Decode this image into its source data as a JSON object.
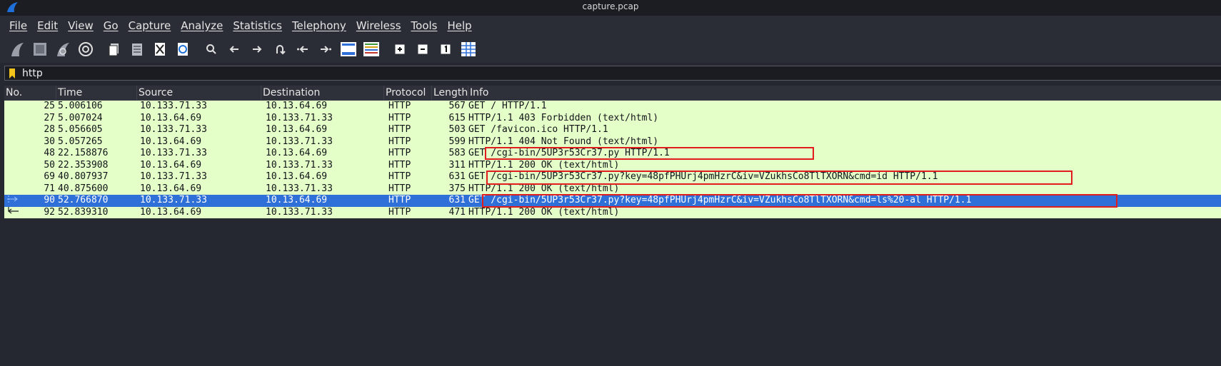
{
  "window": {
    "title": "capture.pcap"
  },
  "menu": [
    "File",
    "Edit",
    "View",
    "Go",
    "Capture",
    "Analyze",
    "Statistics",
    "Telephony",
    "Wireless",
    "Tools",
    "Help"
  ],
  "toolbar": [
    "start-capture-icon",
    "stop-capture-icon",
    "restart-capture-icon",
    "capture-options-icon",
    "open-file-icon",
    "save-file-icon",
    "close-file-icon",
    "reload-file-icon",
    "find-packet-icon",
    "go-back-icon",
    "go-forward-icon",
    "go-to-packet-icon",
    "first-packet-icon",
    "last-packet-icon",
    "auto-scroll-icon",
    "colorize-icon",
    "zoom-in-icon",
    "zoom-out-icon",
    "normal-size-icon",
    "resize-columns-icon"
  ],
  "filter": {
    "value": "http"
  },
  "columns": {
    "no": "No.",
    "time": "Time",
    "source": "Source",
    "destination": "Destination",
    "protocol": "Protocol",
    "length": "Length",
    "info": "Info"
  },
  "packets": [
    {
      "no": "25",
      "time": "5.006106",
      "source": "10.133.71.33",
      "destination": "10.13.64.69",
      "protocol": "HTTP",
      "length": "567",
      "info": "GET / HTTP/1.1"
    },
    {
      "no": "27",
      "time": "5.007024",
      "source": "10.13.64.69",
      "destination": "10.133.71.33",
      "protocol": "HTTP",
      "length": "615",
      "info": "HTTP/1.1 403 Forbidden  (text/html)"
    },
    {
      "no": "28",
      "time": "5.056605",
      "source": "10.133.71.33",
      "destination": "10.13.64.69",
      "protocol": "HTTP",
      "length": "503",
      "info": "GET /favicon.ico HTTP/1.1"
    },
    {
      "no": "30",
      "time": "5.057265",
      "source": "10.13.64.69",
      "destination": "10.133.71.33",
      "protocol": "HTTP",
      "length": "599",
      "info": "HTTP/1.1 404 Not Found  (text/html)"
    },
    {
      "no": "48",
      "time": "22.158876",
      "source": "10.133.71.33",
      "destination": "10.13.64.69",
      "protocol": "HTTP",
      "length": "583",
      "info": "GET /cgi-bin/5UP3r53Cr37.py HTTP/1.1"
    },
    {
      "no": "50",
      "time": "22.353908",
      "source": "10.13.64.69",
      "destination": "10.133.71.33",
      "protocol": "HTTP",
      "length": "311",
      "info": "HTTP/1.1 200 OK  (text/html)"
    },
    {
      "no": "69",
      "time": "40.807937",
      "source": "10.133.71.33",
      "destination": "10.13.64.69",
      "protocol": "HTTP",
      "length": "631",
      "info": "GET /cgi-bin/5UP3r53Cr37.py?key=48pfPHUrj4pmHzrC&iv=VZukhsCo8TlTXORN&cmd=id HTTP/1.1"
    },
    {
      "no": "71",
      "time": "40.875600",
      "source": "10.13.64.69",
      "destination": "10.133.71.33",
      "protocol": "HTTP",
      "length": "375",
      "info": "HTTP/1.1 200 OK  (text/html)"
    },
    {
      "no": "90",
      "time": "52.766870",
      "source": "10.133.71.33",
      "destination": "10.13.64.69",
      "protocol": "HTTP",
      "length": "631",
      "info": "GET /cgi-bin/5UP3r53Cr37.py?key=48pfPHUrj4pmHzrC&iv=VZukhsCo8TlTXORN&cmd=ls%20-al HTTP/1.1"
    },
    {
      "no": "92",
      "time": "52.839310",
      "source": "10.13.64.69",
      "destination": "10.133.71.33",
      "protocol": "HTTP",
      "length": "471",
      "info": "HTTP/1.1 200 OK  (text/html)"
    }
  ],
  "selected_row": 8,
  "colors": {
    "row_bg": "#e4ffc7",
    "selected_bg": "#2f6fd8",
    "annotation": "#e01c1c"
  }
}
